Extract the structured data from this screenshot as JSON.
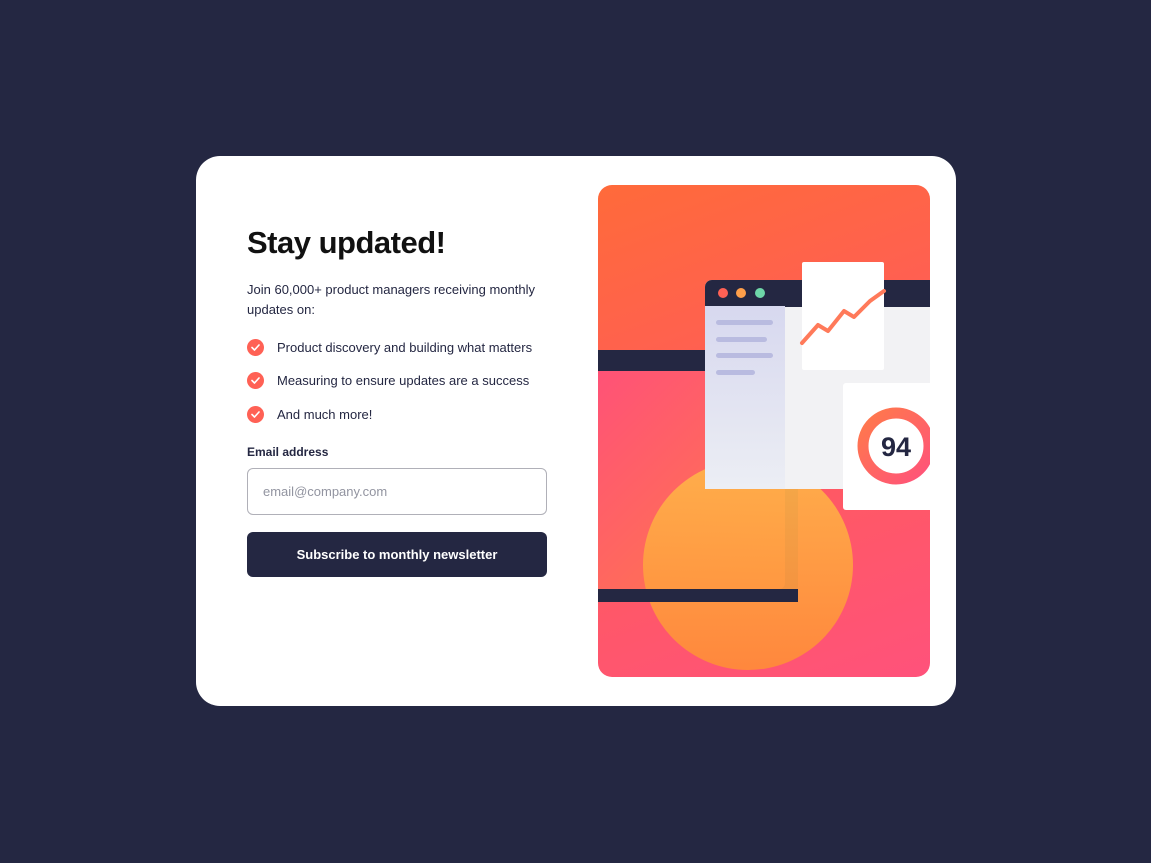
{
  "signup": {
    "title": "Stay updated!",
    "intro": "Join 60,000+ product managers receiving monthly updates on:",
    "features": [
      "Product discovery and building what matters",
      "Measuring to ensure updates are a success",
      "And much more!"
    ],
    "email_label": "Email address",
    "email_placeholder": "email@company.com",
    "email_value": "",
    "submit_label": "Subscribe to monthly newsletter"
  },
  "illustration": {
    "score": "94"
  },
  "colors": {
    "background": "#242742",
    "accent": "#ff6155",
    "card": "#ffffff"
  },
  "icons": [
    "check-icon"
  ]
}
